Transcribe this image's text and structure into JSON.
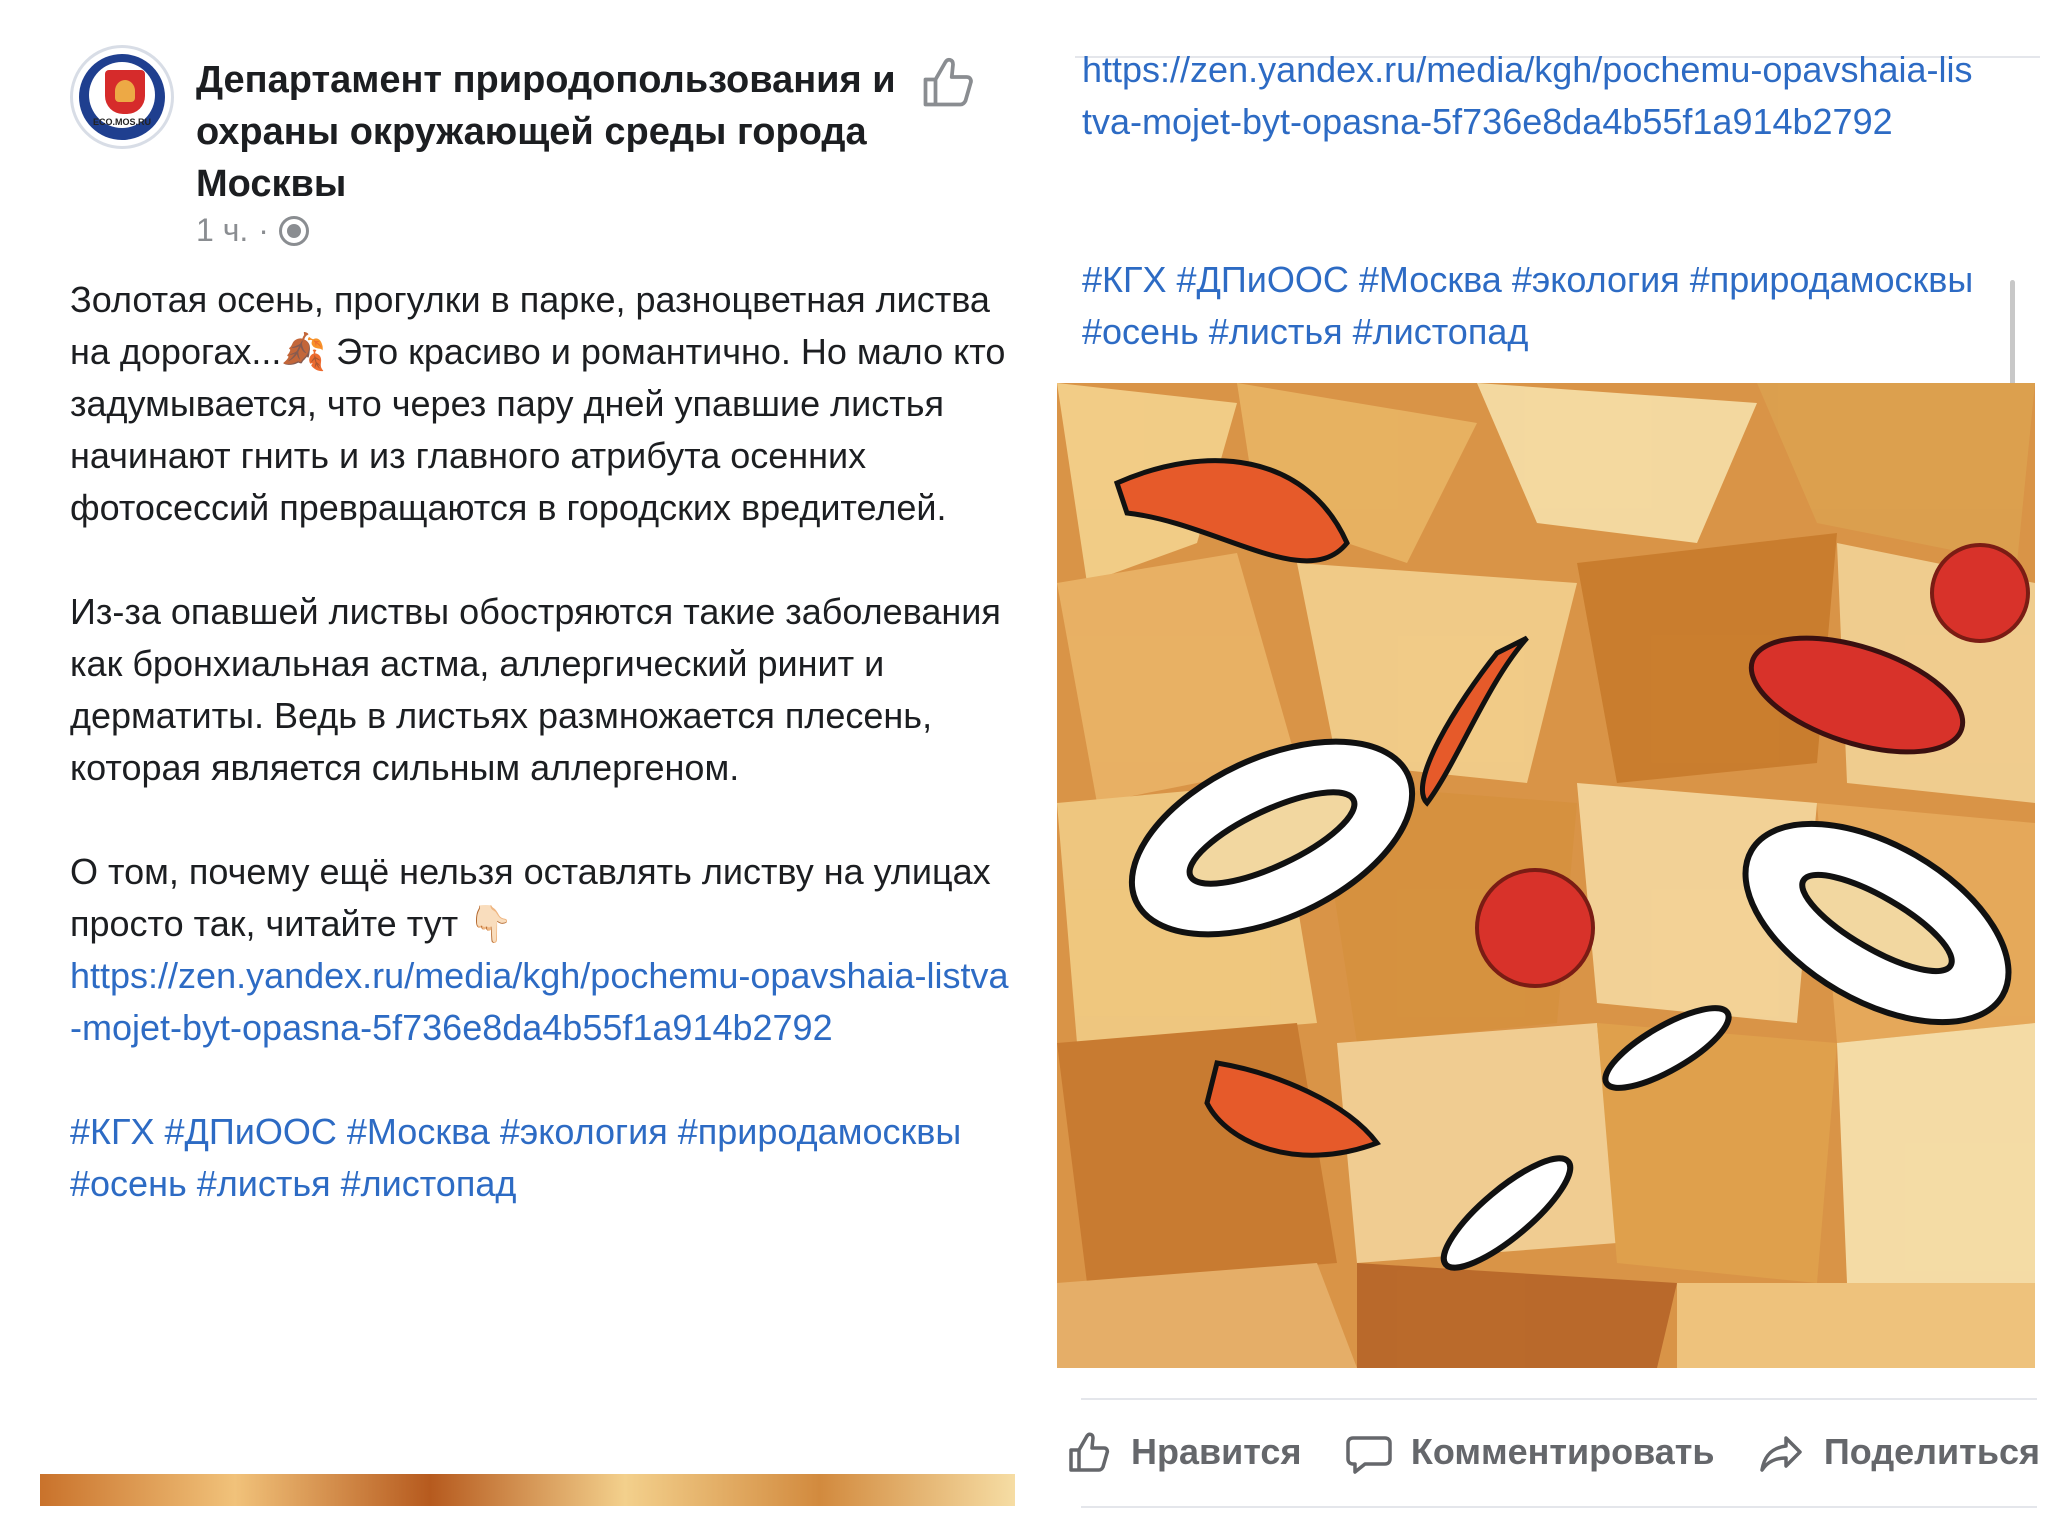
{
  "left_post": {
    "page_name": "Департамент природопользования и охраны окружающей среды города Москвы",
    "avatar_text": "ECO.MOS.RU",
    "time": "1 ч.",
    "separator": "·",
    "paragraph1": "Золотая осень, прогулки в парке, разноцветная листва на дорогах...🍂 Это красиво и романтично. Но мало кто задумывается, что через пару дней упавшие листья начинают гнить и из главного атрибута осенних фотосессий превращаются в городских вредителей.",
    "paragraph2": "Из-за опавшей листвы обостряются такие заболевания как бронхиальная астма, аллергический ринит и дерматиты. Ведь в листьях размножается плесень, которая является сильным аллергеном.",
    "paragraph3": "О том, почему ещё нельзя оставлять листву на улицах просто так, читайте тут 👇🏻",
    "link": "https://zen.yandex.ru/media/kgh/pochemu-opavshaia-listva-mojet-byt-opasna-5f736e8da4b55f1a914b2792",
    "hashtags": "#КГХ #ДПиООС #Москва #экология #природамосквы #осень #листья #листопад"
  },
  "right_post": {
    "link": "https://zen.yandex.ru/media/kgh/pochemu-opavshaia-listva-mojet-byt-opasna-5f736e8da4b55f1a914b2792",
    "hashtags": "#КГХ #ДПиООС #Москва #экология #природамосквы #осень #листья #листопад",
    "actions": {
      "like": "Нравится",
      "comment": "Комментировать",
      "share": "Поделиться"
    }
  },
  "colors": {
    "link": "#2d6bc4",
    "text": "#1c1e21",
    "muted": "#65676b"
  }
}
